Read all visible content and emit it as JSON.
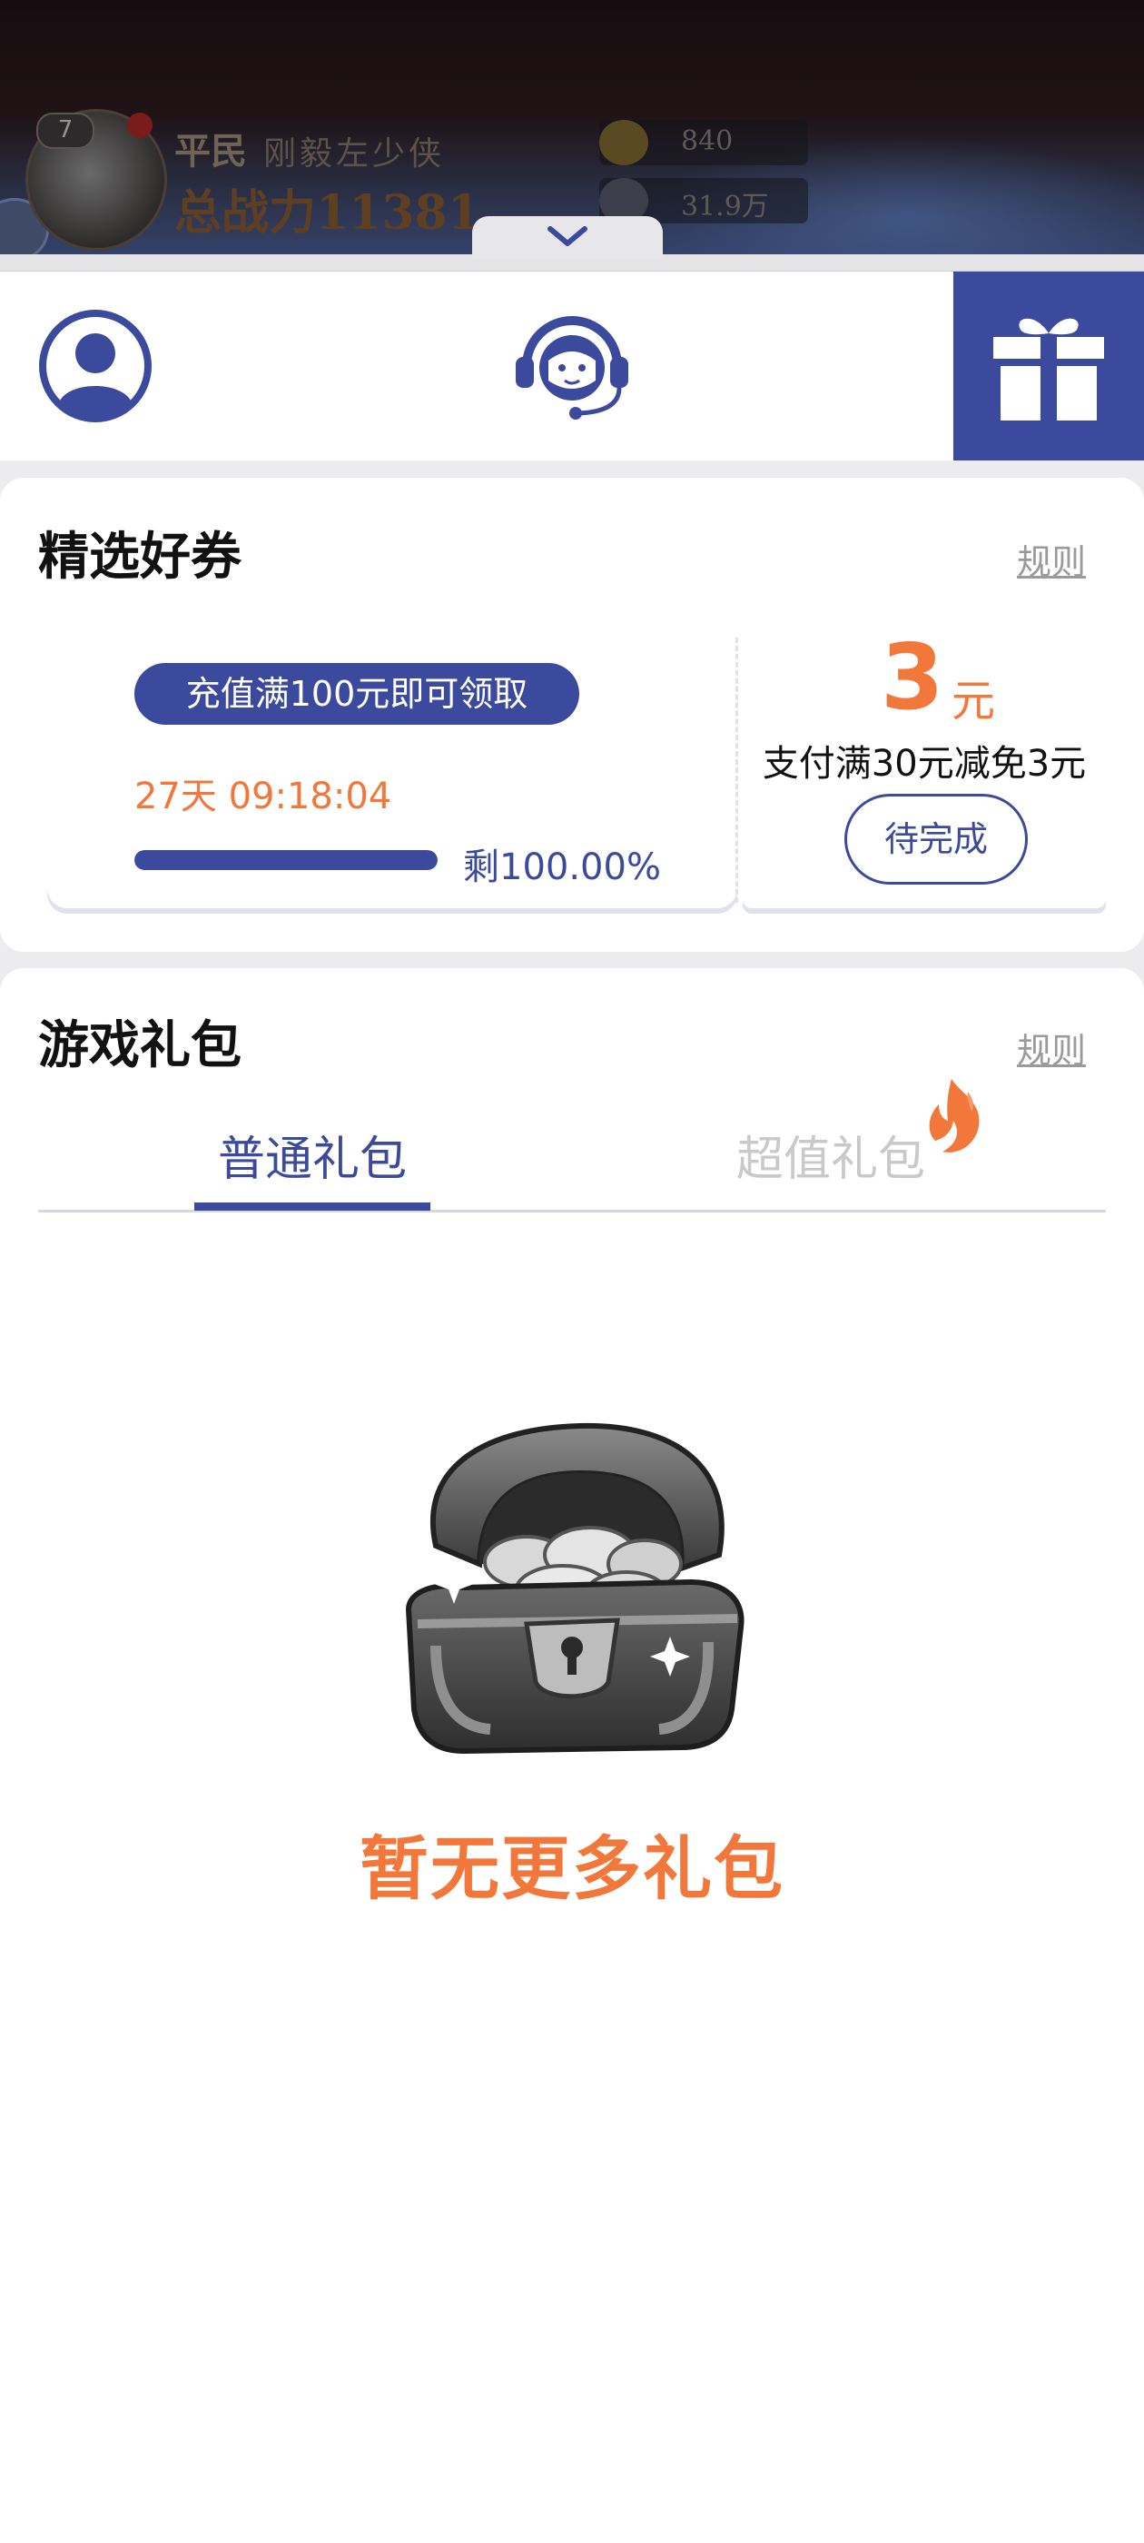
{
  "game_header": {
    "level": "7",
    "rank": "平民",
    "player_name": "刚毅左少侠",
    "power": "总战力11381",
    "resources": [
      {
        "icon": "gold-ingot-icon",
        "value": "840"
      },
      {
        "icon": "gem-icon",
        "value": "31.9万"
      }
    ]
  },
  "icon_bar": {
    "items": [
      {
        "name": "profile",
        "icon": "user-icon"
      },
      {
        "name": "customer-service",
        "icon": "headset-icon"
      },
      {
        "name": "gift",
        "icon": "gift-icon",
        "active": true
      }
    ]
  },
  "coupons": {
    "title": "精选好券",
    "rule_label": "规则",
    "card": {
      "condition": "充值满100元即可领取",
      "countdown": "27天 09:18:04",
      "remaining_label": "剩100.00%",
      "remaining_fraction": 1.0
    },
    "side": {
      "amount": "3",
      "unit": "元",
      "description": "支付满30元减免3元",
      "button_label": "待完成"
    }
  },
  "gifts": {
    "title": "游戏礼包",
    "rule_label": "规则",
    "tabs": [
      {
        "label": "普通礼包",
        "active": true
      },
      {
        "label": "超值礼包",
        "active": false,
        "badge_icon": "fire-icon"
      }
    ],
    "empty_text": "暂无更多礼包"
  },
  "colors": {
    "primary": "#3b4a9c",
    "accent": "#f2773a"
  }
}
